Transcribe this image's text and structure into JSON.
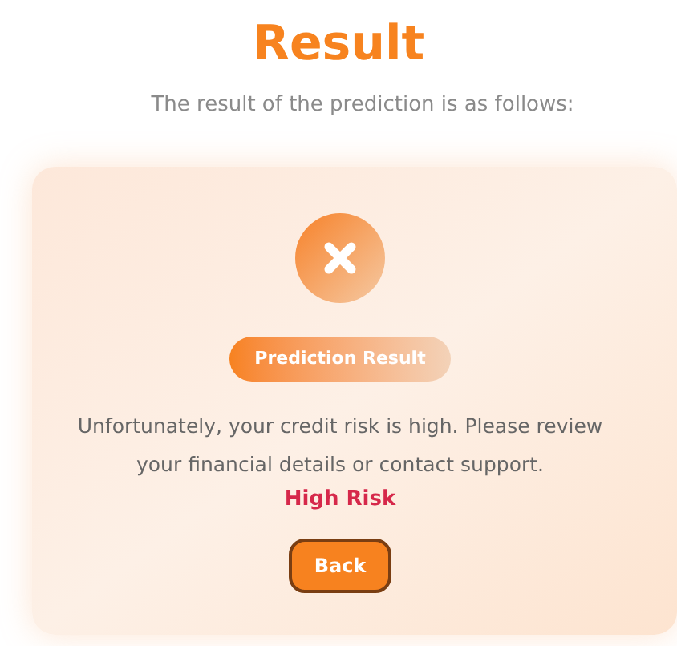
{
  "title": "Result",
  "subtitle": "The result of the prediction is as follows:",
  "card": {
    "outcome": {
      "kind": "high"
    },
    "badge": "Prediction Result",
    "message": "Unfortunately, your credit risk is high. Please review your financial details or contact support.",
    "risk": "High Risk",
    "button": "Back"
  }
}
